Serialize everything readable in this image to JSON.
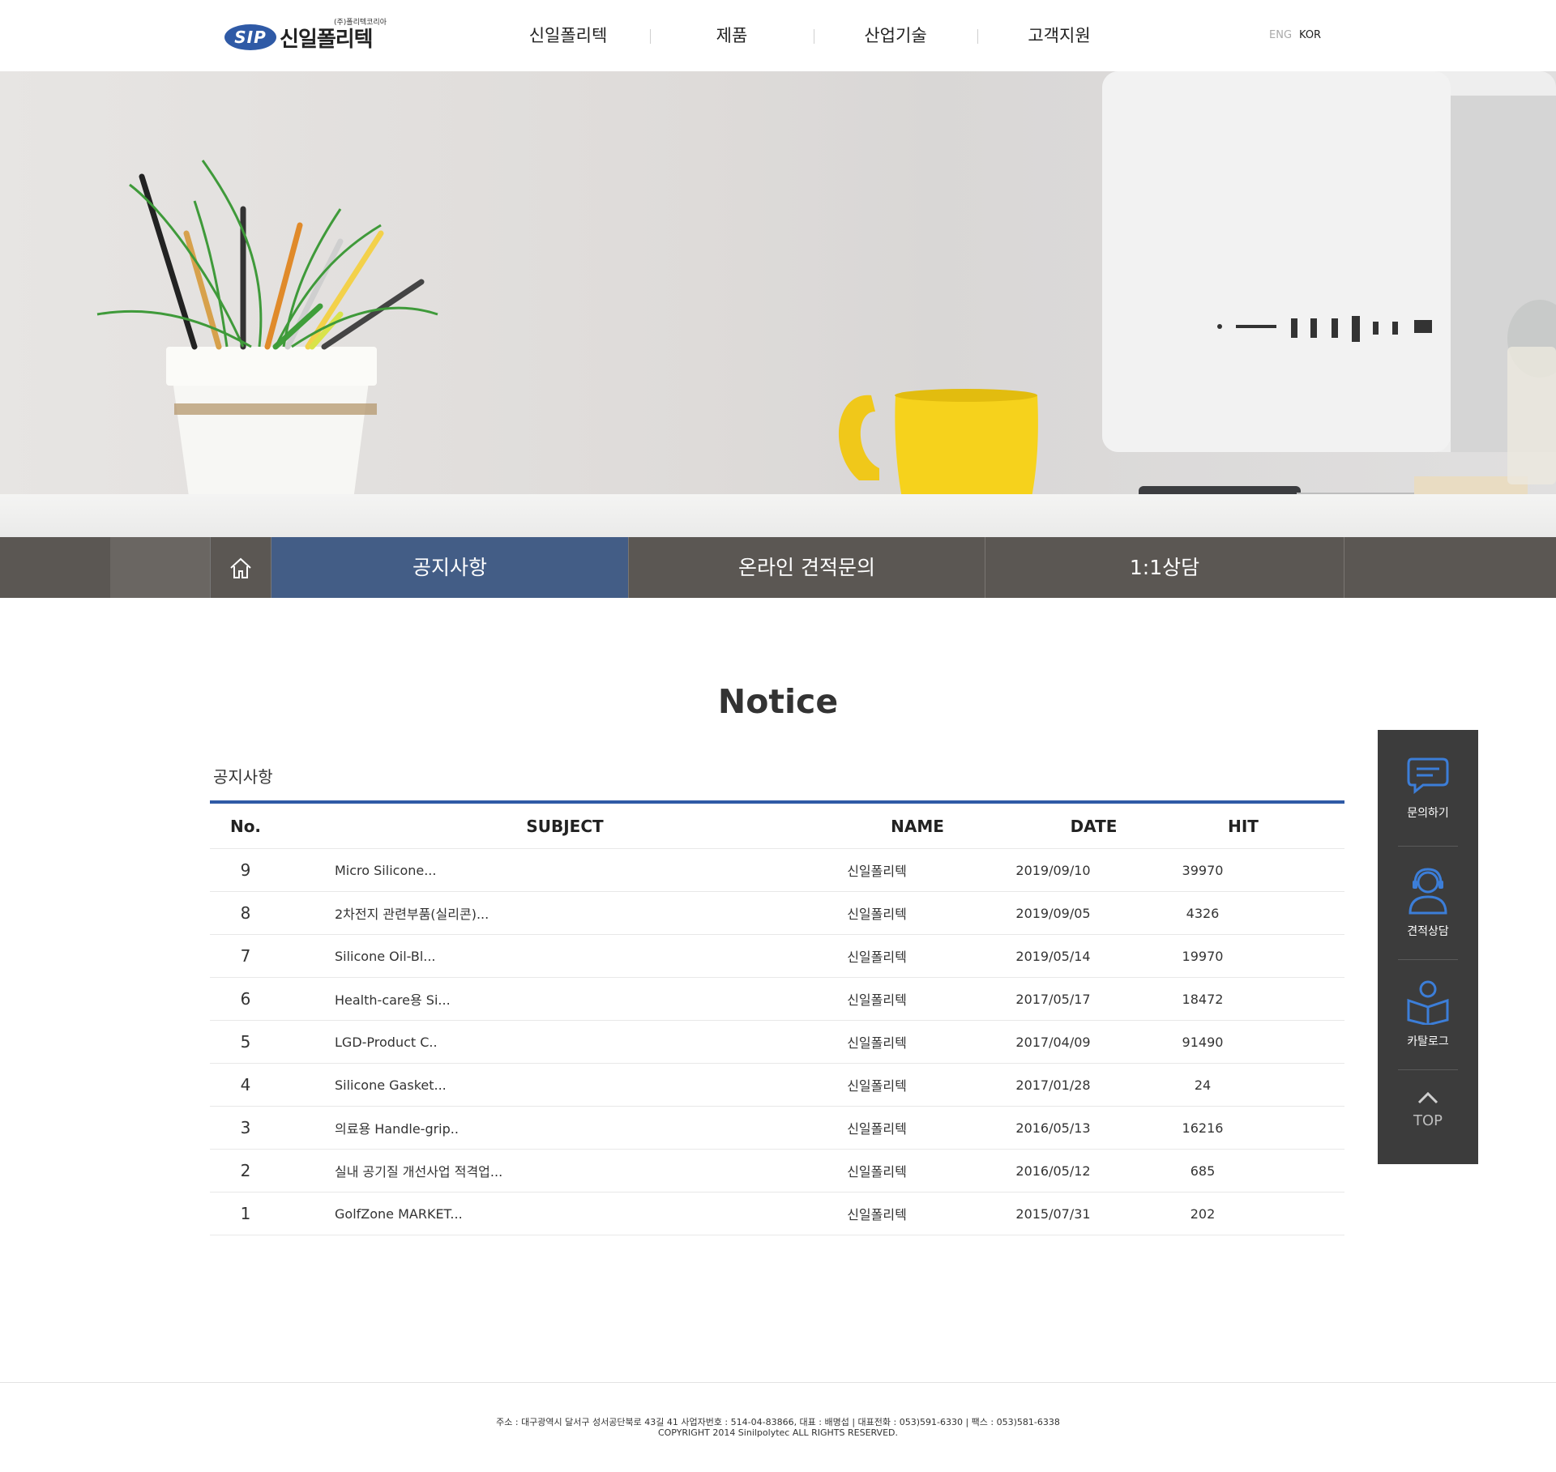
{
  "header": {
    "logo_mark": "SIP",
    "logo_small": "(주)폴리텍코리아",
    "logo_name": "신일폴리텍",
    "nav": [
      "신일폴리텍",
      "제품",
      "산업기술",
      "고객지원"
    ],
    "lang": {
      "eng": "ENG",
      "kor": "KOR"
    }
  },
  "subnav": {
    "tabs": [
      "공지사항",
      "온라인 견적문의",
      "1:1상담"
    ],
    "active": "공지사항"
  },
  "page": {
    "title": "Notice",
    "board_label": "공지사항"
  },
  "table": {
    "headers": {
      "no": "No.",
      "subject": "SUBJECT",
      "name": "NAME",
      "date": "DATE",
      "hit": "HIT"
    },
    "rows": [
      {
        "no": "9",
        "subject": "Micro Silicone...",
        "name": "신일폴리텍",
        "date": "2019/09/10",
        "hit": "39970"
      },
      {
        "no": "8",
        "subject": "2차전지 관련부품(실리콘)...",
        "name": "신일폴리텍",
        "date": "2019/09/05",
        "hit": "4326"
      },
      {
        "no": "7",
        "subject": "Silicone Oil-Bl...",
        "name": "신일폴리텍",
        "date": "2019/05/14",
        "hit": "19970"
      },
      {
        "no": "6",
        "subject": "Health-care용 Si...",
        "name": "신일폴리텍",
        "date": "2017/05/17",
        "hit": "18472"
      },
      {
        "no": "5",
        "subject": "LGD-Product C..",
        "name": "신일폴리텍",
        "date": "2017/04/09",
        "hit": "91490"
      },
      {
        "no": "4",
        "subject": "Silicone Gasket...",
        "name": "신일폴리텍",
        "date": "2017/01/28",
        "hit": "24"
      },
      {
        "no": "3",
        "subject": "의료용 Handle-grip..",
        "name": "신일폴리텍",
        "date": "2016/05/13",
        "hit": "16216"
      },
      {
        "no": "2",
        "subject": "실내 공기질 개선사업 적격업...",
        "name": "신일폴리텍",
        "date": "2016/05/12",
        "hit": "685"
      },
      {
        "no": "1",
        "subject": "GolfZone MARKET...",
        "name": "신일폴리텍",
        "date": "2015/07/31",
        "hit": "202"
      }
    ]
  },
  "quick_menu": {
    "inquiry": "문의하기",
    "estimate": "견적상담",
    "catalog": "카탈로그",
    "top": "TOP"
  },
  "footer": {
    "address": "주소 : 대구광역시 달서구 성서공단북로 43길 41  사업자번호 : 514-04-83866, 대표 : 배명섭 | 대표전화 : 053)591-6330 | 팩스 : 053)581-6338",
    "copyright": "COPYRIGHT 2014 Sinilpolytec ALL RIGHTS RESERVED."
  },
  "colors": {
    "accent": "#2f5aa6",
    "active_tab": "#435d86",
    "subnav_bg": "#5b5753",
    "quick_bg": "#3c3c3c"
  }
}
